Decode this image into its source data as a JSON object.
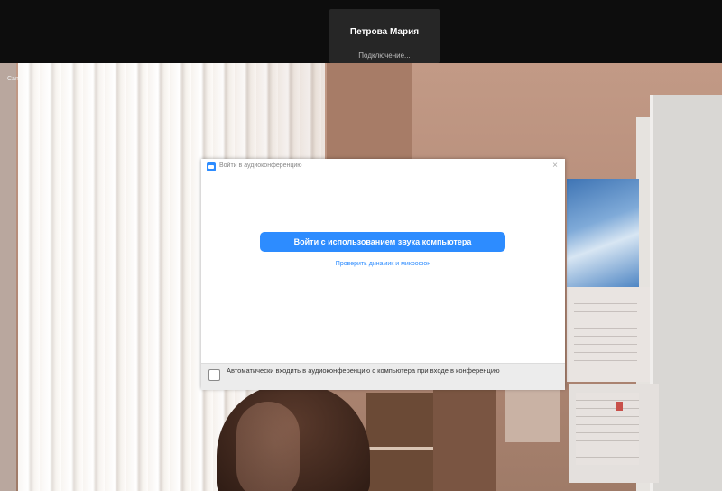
{
  "meeting": {
    "participant_name": "Петрова Мария",
    "status": "Подключение...",
    "camera_label": "Camera"
  },
  "dialog": {
    "title": "Войти в аудиоконференцию",
    "close_icon": "close-icon",
    "join_button_label": "Войти с использованием звука компьютера",
    "test_link_label": "Проверить динамик и микрофон",
    "auto_join_checkbox_label": "Автоматически входить в аудиоконференцию с компьютера при входе в конференцию",
    "auto_join_checked": false
  },
  "colors": {
    "accent": "#2d8cff",
    "top_bar": "#0d0d0d",
    "tab": "#262626",
    "footer": "#ececec"
  }
}
